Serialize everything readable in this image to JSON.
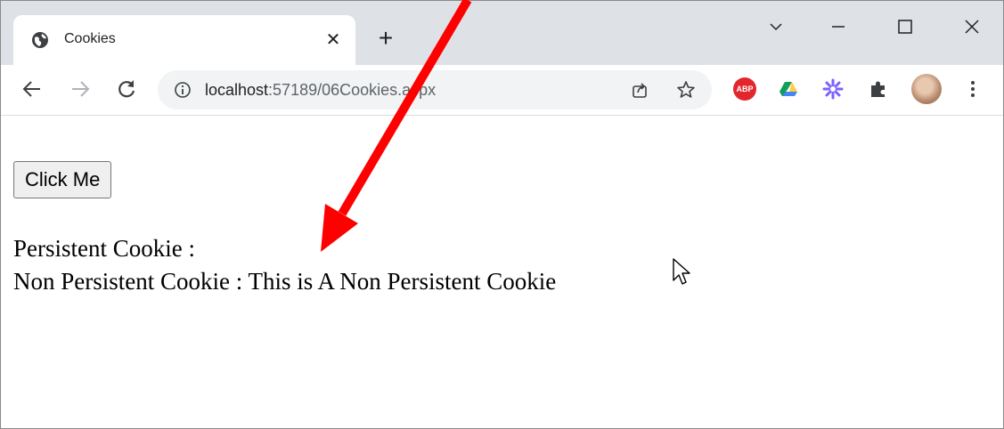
{
  "tab": {
    "title": "Cookies",
    "close_glyph": "✕",
    "new_tab_glyph": "+"
  },
  "window_controls": {
    "icons": [
      "chevron-down-icon",
      "minimize-icon",
      "maximize-icon",
      "close-icon"
    ]
  },
  "toolbar": {
    "url_host": "localhost",
    "url_path": ":57189/06Cookies.aspx",
    "extensions": [
      "adblock-plus-icon",
      "google-drive-icon",
      "asterisk-extension-icon",
      "puzzle-extensions-icon",
      "profile-avatar",
      "kebab-menu-icon"
    ],
    "abp_label": "ABP"
  },
  "page": {
    "button_label": "Click Me",
    "persistent_label": "Persistent Cookie :",
    "non_persistent_label": "Non Persistent Cookie : This is A Non Persistent Cookie"
  },
  "colors": {
    "tabstrip_bg": "#dee1e6",
    "annotation_arrow": "#ff0000",
    "abp_red": "#e3262c"
  }
}
